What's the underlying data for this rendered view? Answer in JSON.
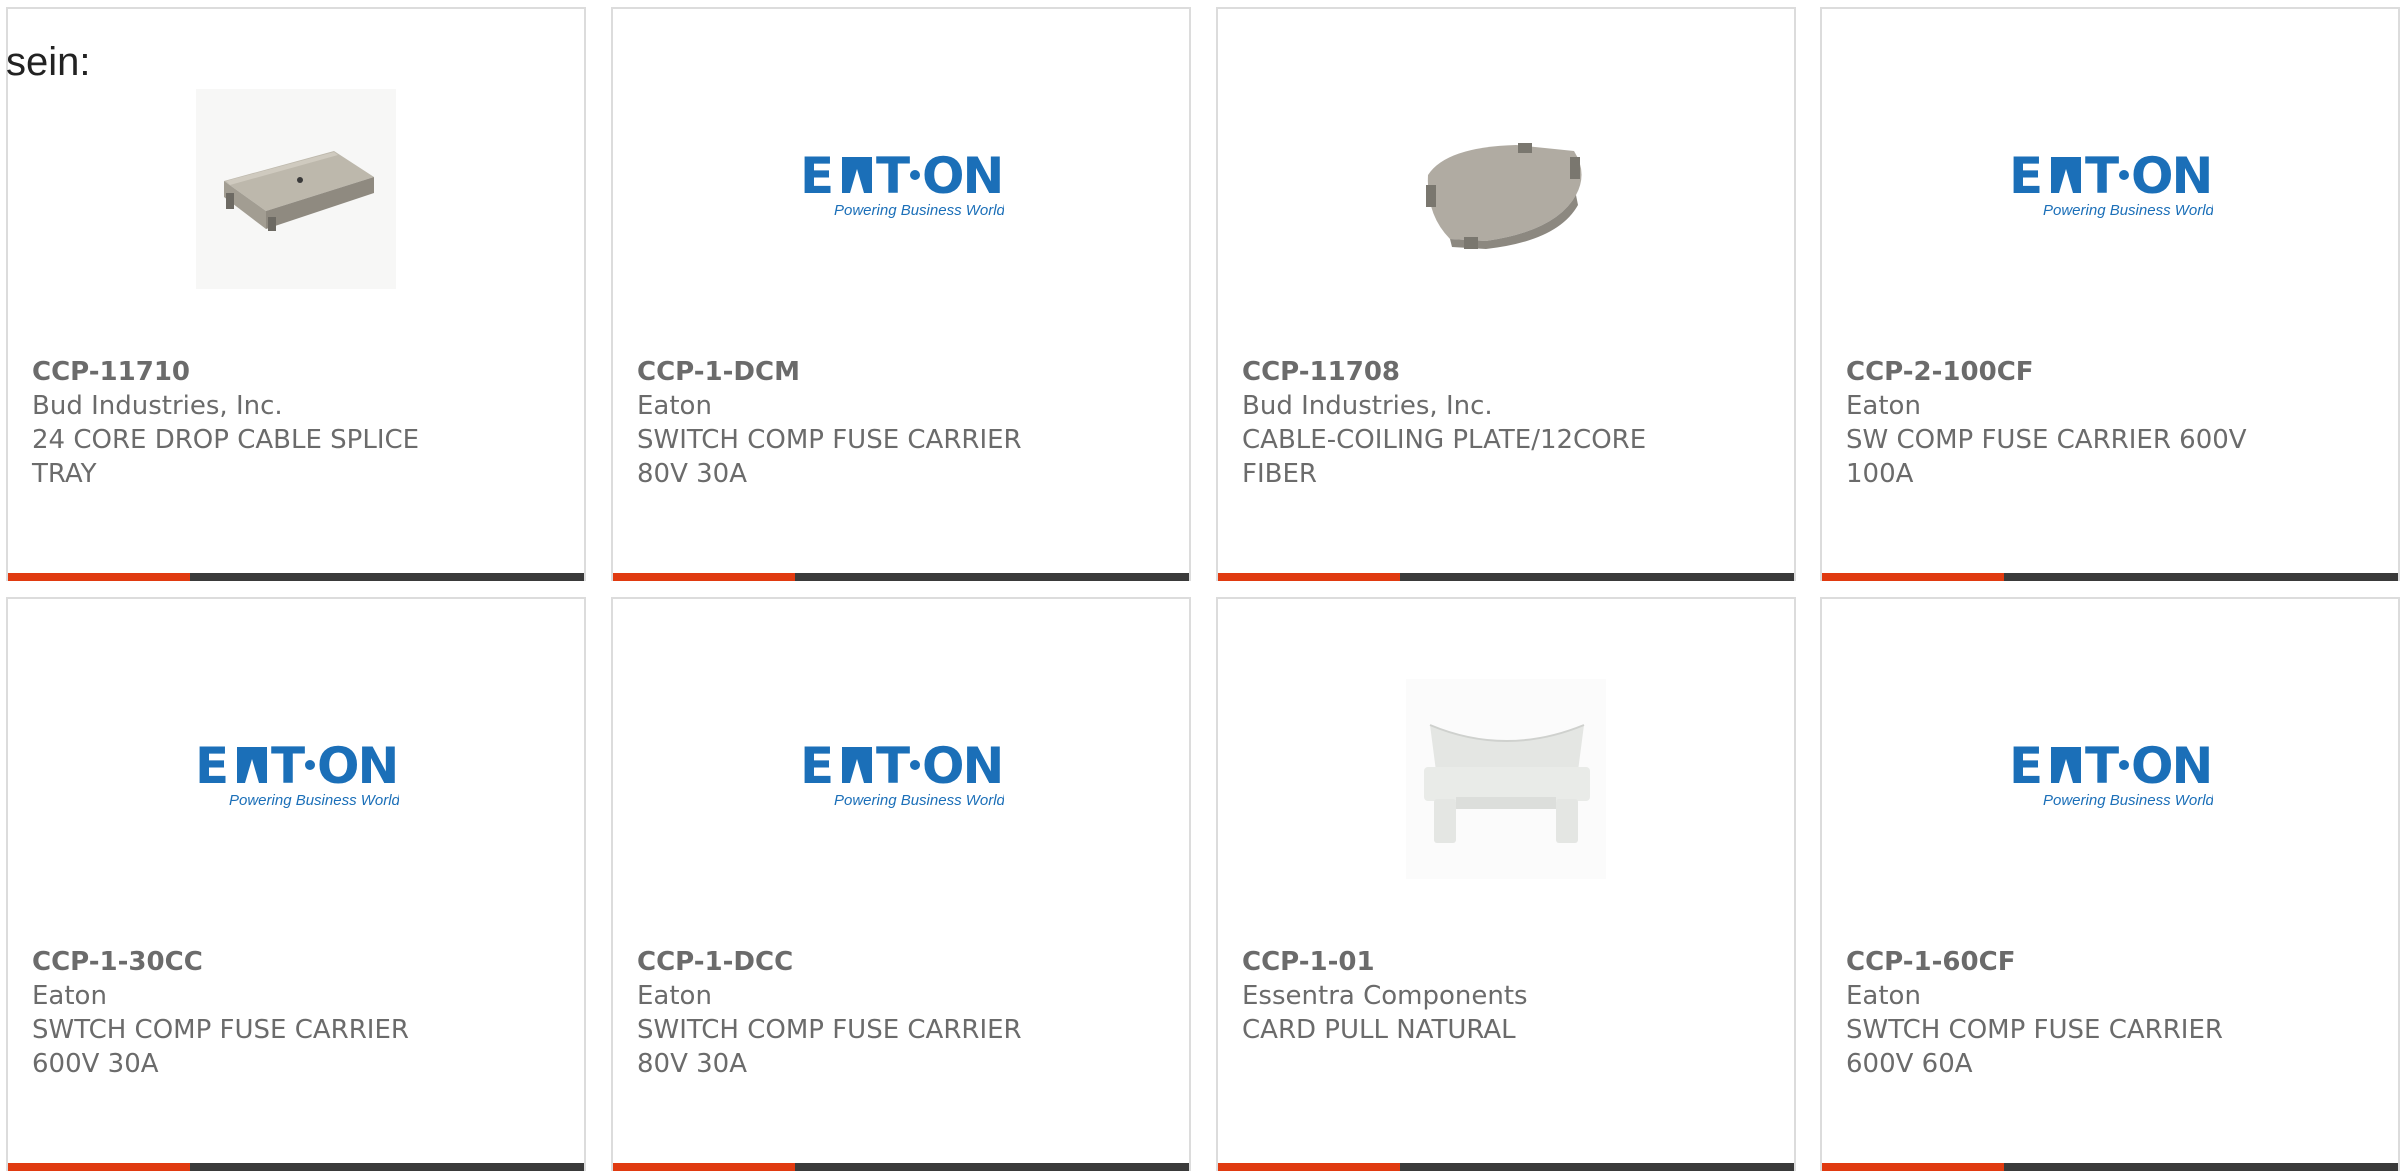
{
  "intro": {
    "text": "sein:"
  },
  "colors": {
    "accent_bar": "#e03a10",
    "dark_bar": "#3a3a3a",
    "eaton_blue": "#1b6fb8",
    "text": "#6b6b6b"
  },
  "products": [
    {
      "part_number": "CCP-11710",
      "manufacturer": "Bud Industries, Inc.",
      "description": "24 CORE DROP CABLE SPLICE TRAY",
      "image": "splice-tray-photo"
    },
    {
      "part_number": "CCP-1-DCM",
      "manufacturer": "Eaton",
      "description": "SWITCH COMP FUSE CARRIER 80V 30A",
      "image": "eaton-logo",
      "logo_tagline": "Powering Business Worldwide"
    },
    {
      "part_number": "CCP-11708",
      "manufacturer": "Bud Industries, Inc.",
      "description": "CABLE-COILING PLATE/12CORE FIBER",
      "image": "coiling-plate-photo"
    },
    {
      "part_number": "CCP-2-100CF",
      "manufacturer": "Eaton",
      "description": "SW COMP FUSE CARRIER 600V 100A",
      "image": "eaton-logo",
      "logo_tagline": "Powering Business Worldwide"
    },
    {
      "part_number": "CCP-1-30CC",
      "manufacturer": "Eaton",
      "description": "SWTCH COMP FUSE CARRIER 600V 30A",
      "image": "eaton-logo",
      "logo_tagline": "Powering Business Worldwide"
    },
    {
      "part_number": "CCP-1-DCC",
      "manufacturer": "Eaton",
      "description": "SWITCH COMP FUSE CARRIER 80V 30A",
      "image": "eaton-logo",
      "logo_tagline": "Powering Business Worldwide"
    },
    {
      "part_number": "CCP-1-01",
      "manufacturer": "Essentra Components",
      "description": "CARD PULL NATURAL",
      "image": "card-pull-photo"
    },
    {
      "part_number": "CCP-1-60CF",
      "manufacturer": "Eaton",
      "description": "SWTCH COMP FUSE CARRIER 600V 60A",
      "image": "eaton-logo",
      "logo_tagline": "Powering Business Worldwide"
    }
  ]
}
